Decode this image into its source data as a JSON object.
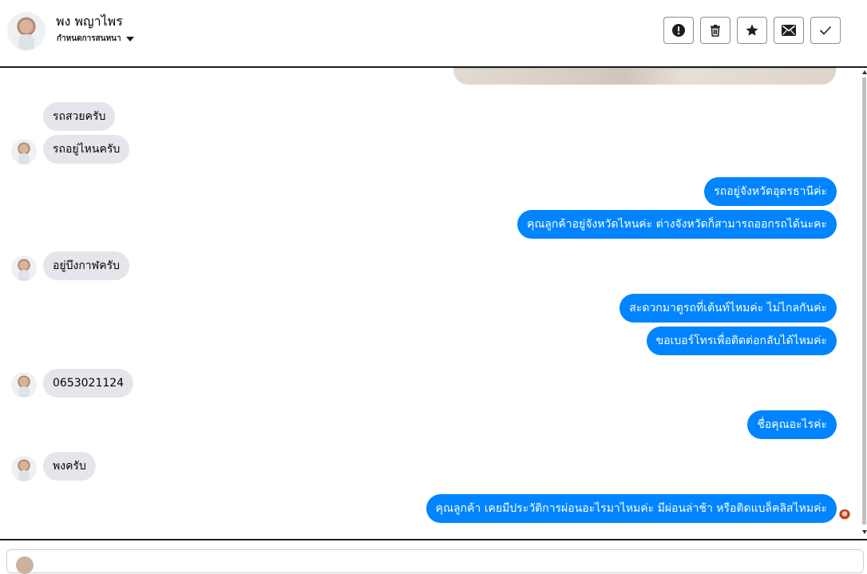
{
  "header": {
    "contact_name": "พง พญาไพร",
    "contact_subtitle": "กำหนดการสนทนา",
    "actions": [
      {
        "name": "report-button",
        "icon": "exclamation-circle-icon"
      },
      {
        "name": "delete-button",
        "icon": "trash-icon"
      },
      {
        "name": "star-button",
        "icon": "star-icon"
      },
      {
        "name": "mark-unread-button",
        "icon": "envelope-icon"
      },
      {
        "name": "mark-done-button",
        "icon": "checkmark-icon"
      }
    ]
  },
  "messages": [
    {
      "side": "in",
      "text": "รถสวยครับ"
    },
    {
      "side": "in",
      "text": "รถอยู่ไหนครับ"
    },
    {
      "side": "out",
      "text": "รถอยู่จังหวัดอุดรธานีค่ะ"
    },
    {
      "side": "out",
      "text": "คุณลูกค้าอยู่จังหวัดไหนค่ะ ต่างจังหวัดก็สามารถออกรถได้นะคะ"
    },
    {
      "side": "in",
      "text": "อยู่บึงกาฬครับ"
    },
    {
      "side": "out",
      "text": "สะดวกมาดูรถที่เต้นท์ไหมค่ะ ไม่ไกลกันค่ะ"
    },
    {
      "side": "out",
      "text": "ขอเบอร์โทรเพื่อติดต่อกลับได้ไหมค่ะ"
    },
    {
      "side": "in",
      "text": "0653021124"
    },
    {
      "side": "out",
      "text": "ชื่อคุณอะไรค่ะ"
    },
    {
      "side": "in",
      "text": "พงครับ"
    },
    {
      "side": "out",
      "text": "คุณลูกค้า เคยมีประวัติการผ่อนอะไรมาไหมค่ะ มีผ่อนล่าช้า หรือติดแบล็คลิสไหมค่ะ"
    }
  ],
  "colors": {
    "outgoing_bubble": "#0084ff",
    "incoming_bubble": "#e4e6eb"
  }
}
